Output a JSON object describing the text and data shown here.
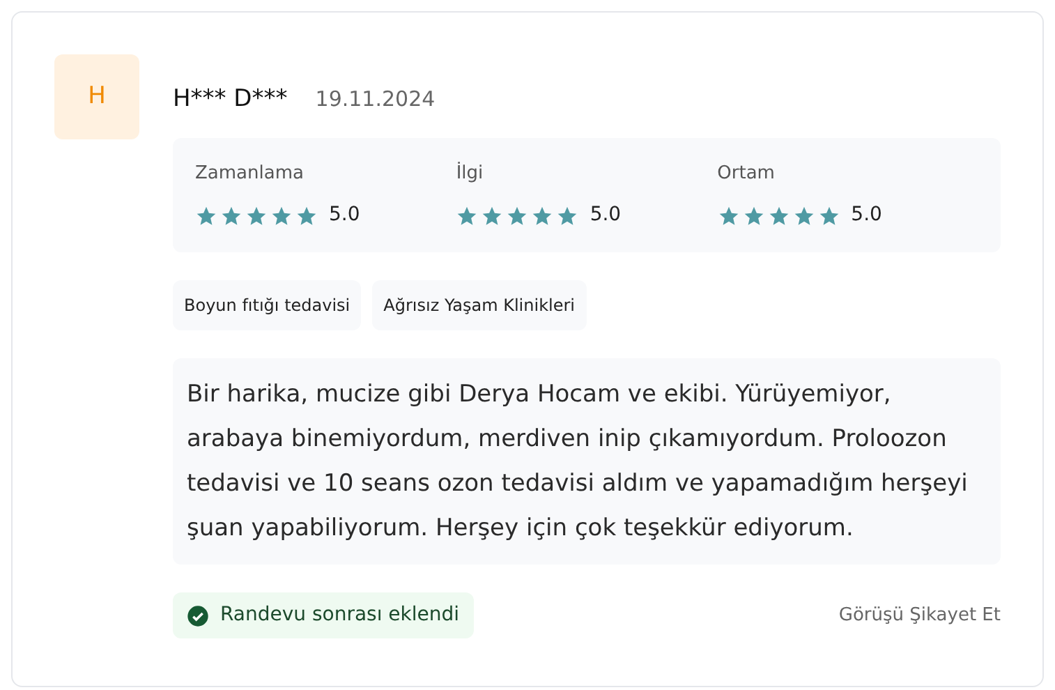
{
  "review": {
    "avatar": "H",
    "author": "H*** D***",
    "date": "19.11.2024",
    "ratings": [
      {
        "label": "Zamanlama",
        "stars": 5,
        "score": "5.0"
      },
      {
        "label": "İlgi",
        "stars": 5,
        "score": "5.0"
      },
      {
        "label": "Ortam",
        "stars": 5,
        "score": "5.0"
      }
    ],
    "tags": [
      "Boyun fıtığı tedavisi",
      "Ağrısız Yaşam Klinikleri"
    ],
    "text": "Bir harika, mucize gibi Derya Hocam ve ekibi. Yürüyemiyor, arabaya binemiyordum, merdiven inip çıkamıyordum. Proloozon tedavisi ve 10 seans ozon tedavisi aldım ve yapamadığım herşeyi şuan yapabiliyorum. Herşey için çok teşekkür ediyorum.",
    "verified_badge": "Randevu sonrası eklendi",
    "report_link": "Görüşü Şikayet Et"
  }
}
